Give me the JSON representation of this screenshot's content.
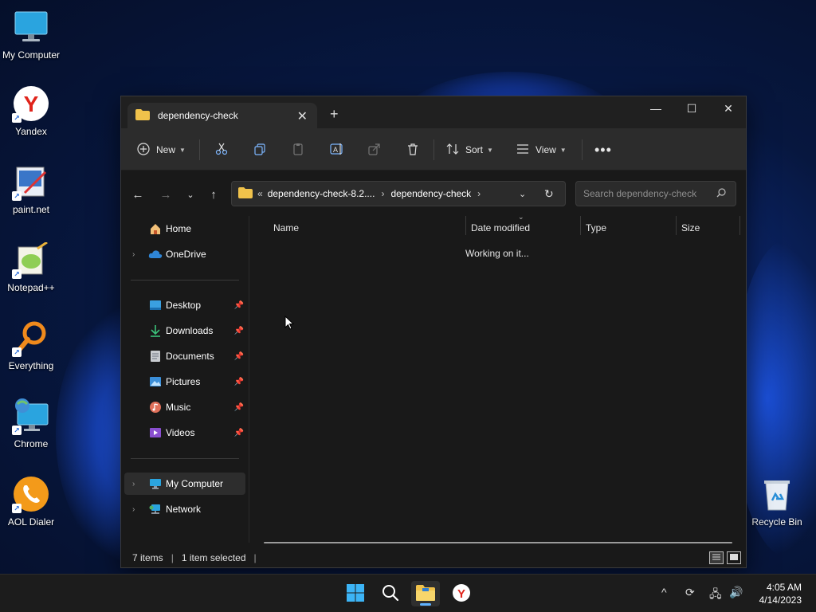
{
  "desktop": {
    "icons": [
      {
        "label": "My Computer",
        "icon": "monitor-icon"
      },
      {
        "label": "Yandex",
        "icon": "yandex-icon"
      },
      {
        "label": "paint.net",
        "icon": "paintnet-icon"
      },
      {
        "label": "Notepad++",
        "icon": "notepadpp-icon"
      },
      {
        "label": "Everything",
        "icon": "everything-search-icon"
      },
      {
        "label": "Chrome",
        "icon": "chrome-shortcut-icon"
      },
      {
        "label": "AOL Dialer",
        "icon": "aol-phone-icon"
      },
      {
        "label": "Recycle Bin",
        "icon": "recycle-bin-icon"
      }
    ]
  },
  "window": {
    "tab_title": "dependency-check",
    "toolbar": {
      "new_label": "New",
      "sort_label": "Sort",
      "view_label": "View"
    },
    "address": {
      "overflow": "«",
      "crumbs": [
        "dependency-check-8.2....",
        "dependency-check"
      ]
    },
    "search_placeholder": "Search dependency-check",
    "sidebar": {
      "top": [
        {
          "label": "Home",
          "icon": "home-icon"
        },
        {
          "label": "OneDrive",
          "icon": "cloud-icon"
        }
      ],
      "quick_access": [
        {
          "label": "Desktop",
          "icon": "desktop-folder-icon"
        },
        {
          "label": "Downloads",
          "icon": "download-icon"
        },
        {
          "label": "Documents",
          "icon": "document-icon"
        },
        {
          "label": "Pictures",
          "icon": "pictures-icon"
        },
        {
          "label": "Music",
          "icon": "music-icon"
        },
        {
          "label": "Videos",
          "icon": "videos-icon"
        }
      ],
      "bottom": [
        {
          "label": "My Computer",
          "icon": "monitor-icon"
        },
        {
          "label": "Network",
          "icon": "network-icon"
        }
      ]
    },
    "columns": [
      "Name",
      "Date modified",
      "Type",
      "Size"
    ],
    "loading_text": "Working on it...",
    "status": {
      "items": "7 items",
      "selected": "1 item selected"
    }
  },
  "taskbar": {
    "time": "4:05 AM",
    "date": "4/14/2023"
  },
  "colors": {
    "accent": "#5fb2ff",
    "folder": "#f0c24b",
    "window_bg": "#191919",
    "toolbar_bg": "#2c2c2c"
  }
}
